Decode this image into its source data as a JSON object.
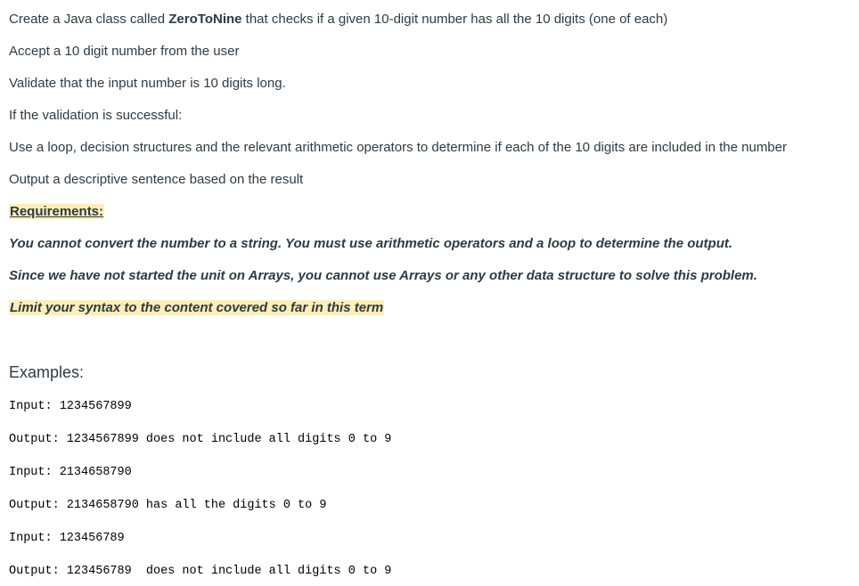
{
  "intro": {
    "before": "Create a Java class called ",
    "class_name": "ZeroToNine",
    "after": " that checks if a given 10-digit number has all the 10 digits (one of each)"
  },
  "steps": [
    "Accept a 10 digit number from the user",
    "Validate that the input number is 10 digits long.",
    "If the validation is successful:",
    "Use a loop, decision structures and the relevant arithmetic operators to determine if each of the 10 digits are included in the number",
    "Output a descriptive sentence based on the result"
  ],
  "requirements": {
    "heading": "Requirements:",
    "items": [
      "You cannot convert the number to a string. You must use arithmetic operators and a loop to determine the output.",
      "Since we have not started the unit on Arrays, you cannot use Arrays or any other data structure to solve this problem.",
      "Limit your syntax to the content covered so far in this term"
    ]
  },
  "examples": {
    "heading": "Examples:",
    "lines": [
      "Input: 1234567899",
      "Output: 1234567899 does not include all digits 0 to 9",
      "Input: 2134658790",
      "Output: 2134658790 has all the digits 0 to 9",
      "Input: 123456789",
      "Output: 123456789  does not include all digits 0 to 9"
    ]
  },
  "colors": {
    "text": "#2d3b45",
    "highlight": "#fbeeb8",
    "code_text": "#000000"
  }
}
